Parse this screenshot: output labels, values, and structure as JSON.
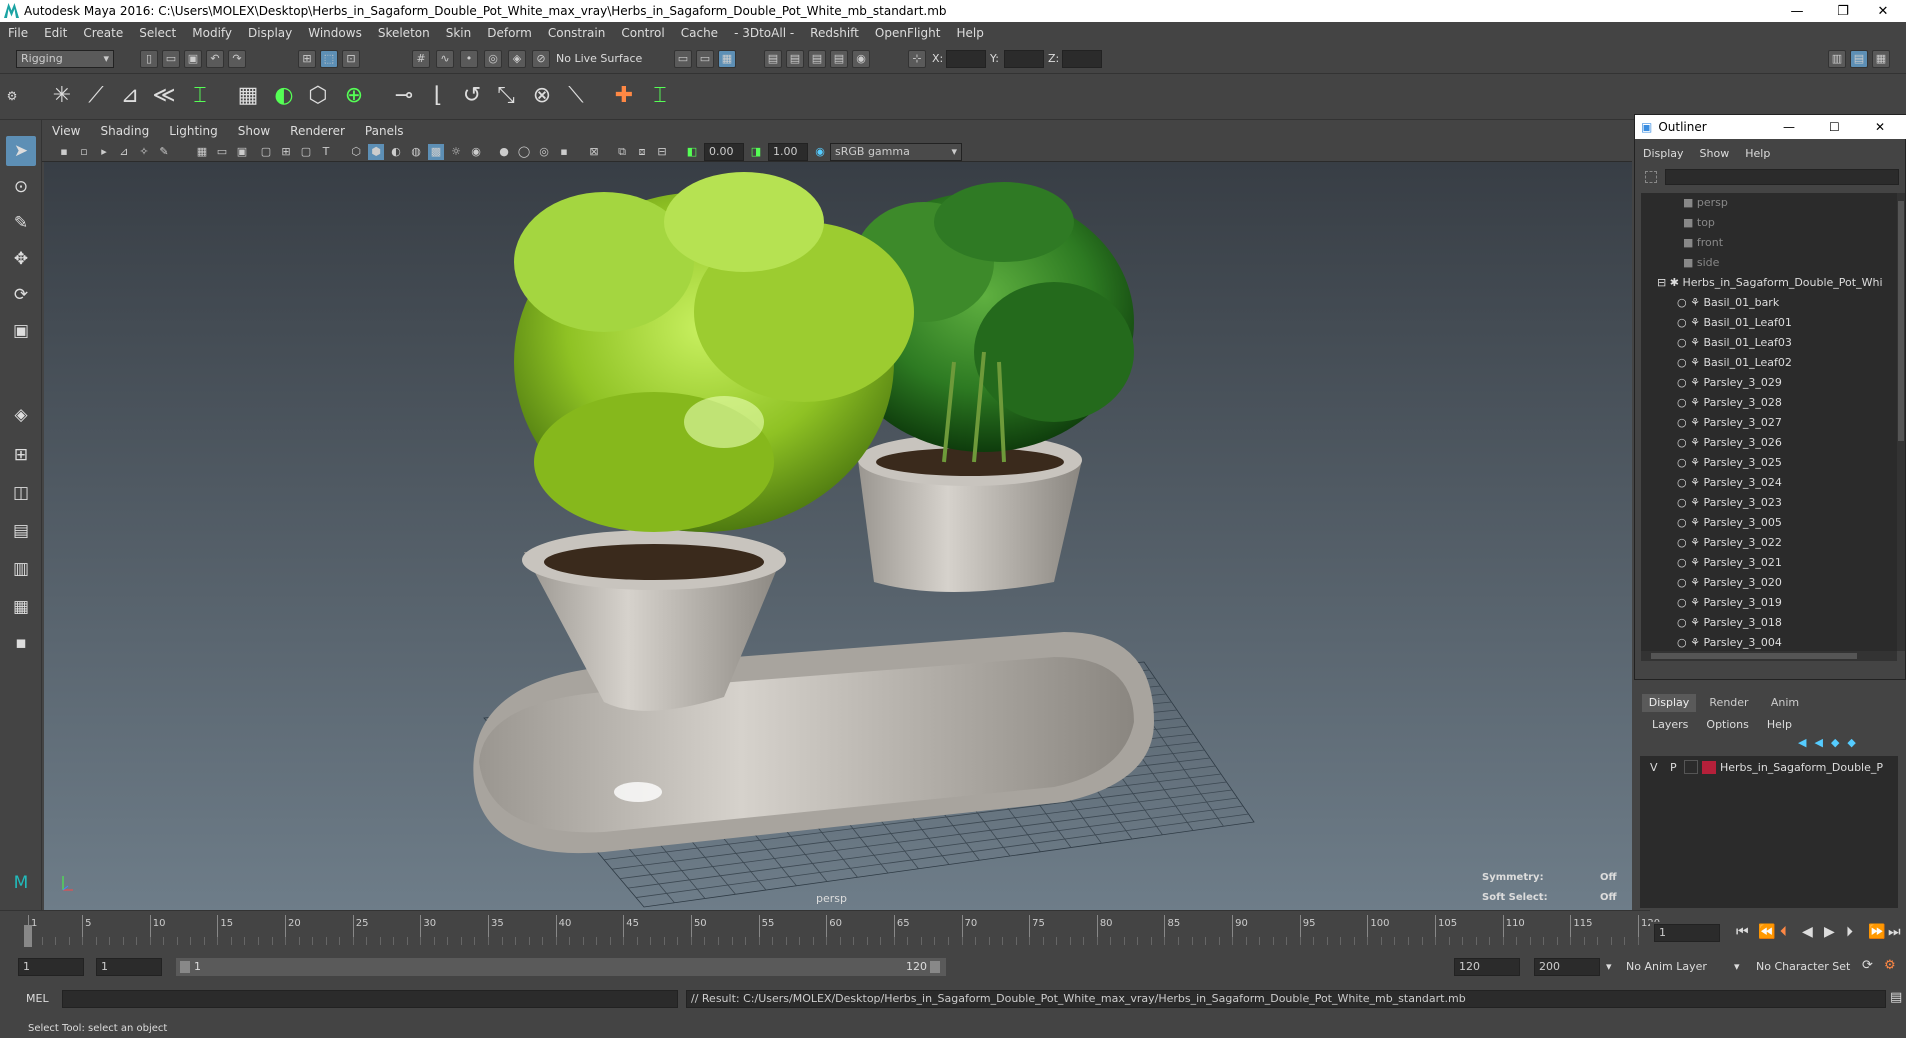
{
  "title": "Autodesk Maya 2016: C:\\Users\\MOLEX\\Desktop\\Herbs_in_Sagaform_Double_Pot_White_max_vray\\Herbs_in_Sagaform_Double_Pot_White_mb_standart.mb",
  "window_controls": {
    "minimize": "—",
    "restore": "❐",
    "close": "✕"
  },
  "menu": [
    "File",
    "Edit",
    "Create",
    "Select",
    "Modify",
    "Display",
    "Windows",
    "Skeleton",
    "Skin",
    "Deform",
    "Constrain",
    "Control",
    "Cache",
    "- 3DtoAll -",
    "Redshift",
    "OpenFlight",
    "Help"
  ],
  "status_line": {
    "menu_set": "Rigging",
    "live_surface": "No Live Surface",
    "x_label": "X:",
    "y_label": "Y:",
    "z_label": "Z:"
  },
  "panel_menu": [
    "View",
    "Shading",
    "Lighting",
    "Show",
    "Renderer",
    "Panels"
  ],
  "panel_toolbar": {
    "exposure": "0.00",
    "gamma": "1.00",
    "color_space": "sRGB gamma"
  },
  "viewport": {
    "camera_label": "persp",
    "symmetry_label": "Symmetry:",
    "symmetry_value": "Off",
    "soft_select_label": "Soft Select:",
    "soft_select_value": "Off"
  },
  "outliner": {
    "title": "Outliner",
    "menu": [
      "Display",
      "Show",
      "Help"
    ],
    "cameras": [
      "persp",
      "top",
      "front",
      "side"
    ],
    "group": "Herbs_in_Sagaform_Double_Pot_Whi",
    "children": [
      "Basil_01_bark",
      "Basil_01_Leaf01",
      "Basil_01_Leaf03",
      "Basil_01_Leaf02",
      "Parsley_3_029",
      "Parsley_3_028",
      "Parsley_3_027",
      "Parsley_3_026",
      "Parsley_3_025",
      "Parsley_3_024",
      "Parsley_3_023",
      "Parsley_3_005",
      "Parsley_3_022",
      "Parsley_3_021",
      "Parsley_3_020",
      "Parsley_3_019",
      "Parsley_3_018",
      "Parsley_3_004"
    ]
  },
  "layer_editor": {
    "tabs": [
      "Display",
      "Render",
      "Anim"
    ],
    "menu": [
      "Layers",
      "Options",
      "Help"
    ],
    "layer": {
      "v": "V",
      "p": "P",
      "name": "Herbs_in_Sagaform_Double_P",
      "color": "#b5203a"
    }
  },
  "timeline": {
    "ticks": [
      "1",
      "5",
      "10",
      "15",
      "20",
      "25",
      "30",
      "35",
      "40",
      "45",
      "50",
      "55",
      "60",
      "65",
      "70",
      "75",
      "80",
      "85",
      "90",
      "95",
      "100",
      "105",
      "110",
      "115",
      "120"
    ],
    "current_frame": "1"
  },
  "range": {
    "start": "1",
    "start_inner": "1",
    "slider_start": "1",
    "slider_end": "120",
    "end_inner": "120",
    "end": "200",
    "anim_layer": "No Anim Layer",
    "character_set": "No Character Set"
  },
  "command_line": {
    "language": "MEL",
    "result": "// Result: C:/Users/MOLEX/Desktop/Herbs_in_Sagaform_Double_Pot_White_max_vray/Herbs_in_Sagaform_Double_Pot_White_mb_standart.mb"
  },
  "help_line": "Select Tool: select an object"
}
